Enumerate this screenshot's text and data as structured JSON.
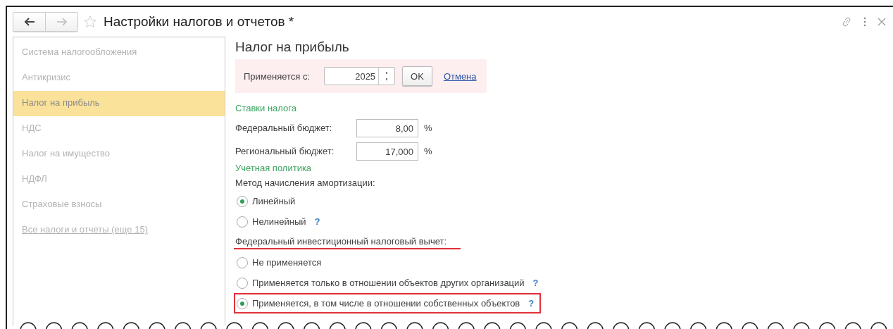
{
  "window": {
    "title": "Настройки налогов и отчетов *"
  },
  "sidebar": {
    "items": [
      {
        "label": "Система налогообложения",
        "kind": "item",
        "selected": false
      },
      {
        "label": "Антикризис",
        "kind": "item",
        "selected": false
      },
      {
        "label": "Налог на прибыль",
        "kind": "item",
        "selected": true
      },
      {
        "label": "НДС",
        "kind": "item",
        "selected": false
      },
      {
        "label": "Налог на имущество",
        "kind": "item",
        "selected": false
      },
      {
        "label": "НДФЛ",
        "kind": "item",
        "selected": false
      },
      {
        "label": "Страховые взносы",
        "kind": "item",
        "selected": false
      },
      {
        "label": "Все налоги и отчеты (еще 15)",
        "kind": "link",
        "selected": false
      }
    ]
  },
  "section": {
    "title": "Налог на прибыль",
    "apply_panel": {
      "label": "Применяется с:",
      "year": "2025",
      "ok": "OK",
      "cancel": "Отмена"
    },
    "groups": [
      {
        "kind": "heading",
        "text": "Ставки налога"
      },
      {
        "kind": "rate",
        "label": "Федеральный бюджет:",
        "value": "8,00",
        "unit": "%"
      },
      {
        "kind": "rate",
        "label": "Региональный бюджет:",
        "value": "17,000",
        "unit": "%"
      },
      {
        "kind": "heading",
        "text": "Учетная политика"
      },
      {
        "kind": "radio",
        "label": "Метод начисления амортизации:",
        "highlighted": false,
        "options": [
          {
            "label": "Линейный",
            "selected": true,
            "highlighted": false
          },
          {
            "label": "Нелинейный",
            "help": "?",
            "selected": false,
            "highlighted": false
          }
        ]
      },
      {
        "kind": "radio",
        "label": "Федеральный инвестиционный налоговый вычет:",
        "highlighted": true,
        "options": [
          {
            "label": "Не применяется",
            "selected": false,
            "highlighted": false
          },
          {
            "label": "Применяется только в отношении объектов других организаций",
            "help": "?",
            "selected": false,
            "highlighted": false
          },
          {
            "label": "Применяется, в том числе в отношении собственных объектов",
            "help": "?",
            "selected": true,
            "highlighted": true
          }
        ]
      }
    ]
  }
}
